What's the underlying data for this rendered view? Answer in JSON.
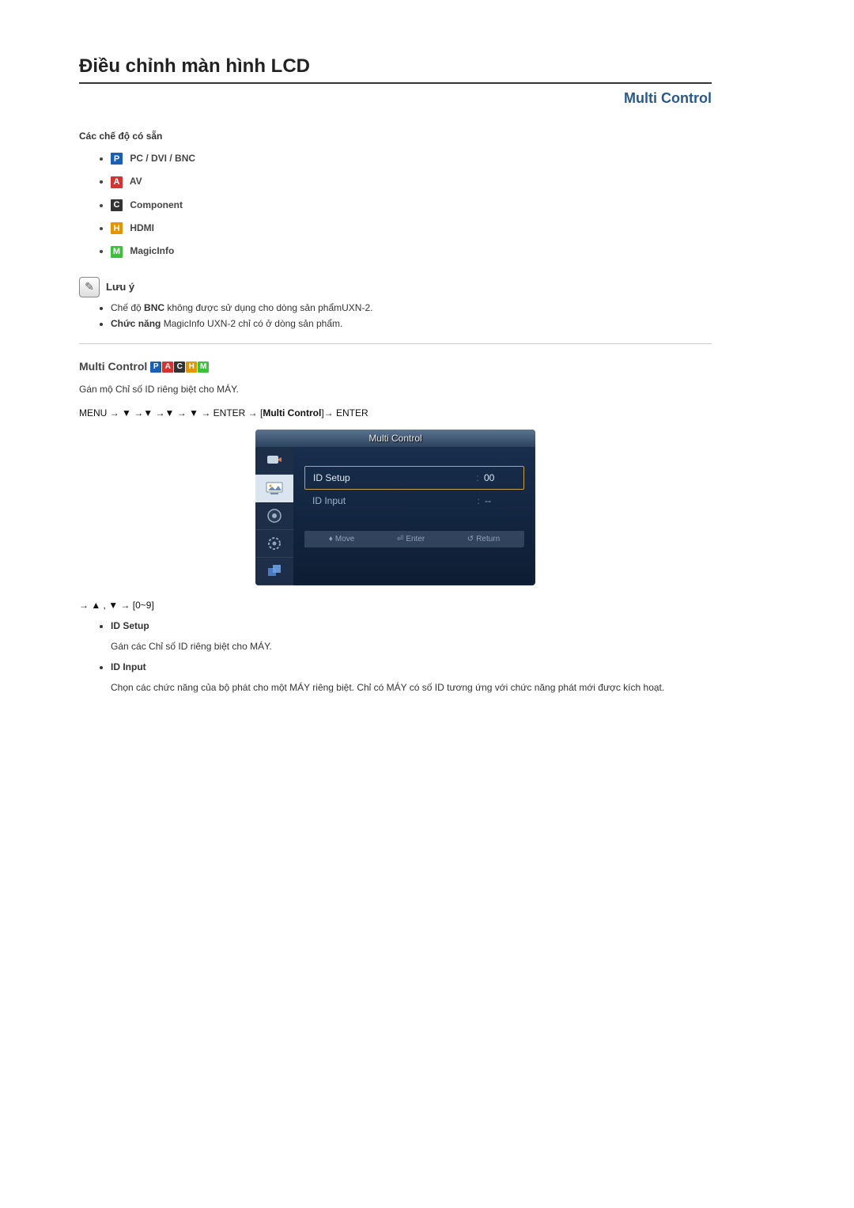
{
  "page_title": "Điều chỉnh màn hình LCD",
  "section_right": "Multi Control",
  "modes_heading": "Các chế độ có sẵn",
  "modes": {
    "pc": "PC / DVI / BNC",
    "av": "AV",
    "component": "Component",
    "hdmi": "HDMI",
    "magicinfo": "MagicInfo"
  },
  "mode_letters": {
    "p": "P",
    "a": "A",
    "c": "C",
    "h": "H",
    "m": "M"
  },
  "note_label": "Lưu ý",
  "notes": {
    "n1_pre": "Chế độ ",
    "n1_bold": "BNC",
    "n1_post": " không được sử dụng cho dòng sản phẩmUXN-2.",
    "n2_pre": "Chức năng",
    "n2_post": " MagicInfo UXN-2 chỉ có ở dòng sản phẩm."
  },
  "subheading": "Multi Control",
  "desc_assign": "Gán mộ Chỉ số ID riêng biệt cho MÁY.",
  "menu_path": {
    "menu": "MENU",
    "arrow": "→",
    "down": "▼",
    "enter": "ENTER",
    "mc": "Multi Control"
  },
  "osd": {
    "title": "Multi Control",
    "row1_label": "ID Setup",
    "row1_value": "00",
    "row2_label": "ID Input",
    "row2_value": "--",
    "move": "Move",
    "enter": "Enter",
    "return": "Return"
  },
  "nav_line": "→ ▲ , ▼ → [0~9]",
  "items": {
    "id_setup_h": "ID Setup",
    "id_setup_t": "Gán các Chỉ số ID riêng biệt cho MÁY.",
    "id_input_h": "ID Input",
    "id_input_t": "Chọn các chức năng của bộ phát cho một MÁY riêng biệt. Chỉ có MÁY có số ID tương ứng với chức năng phát mới được kích hoạt."
  }
}
